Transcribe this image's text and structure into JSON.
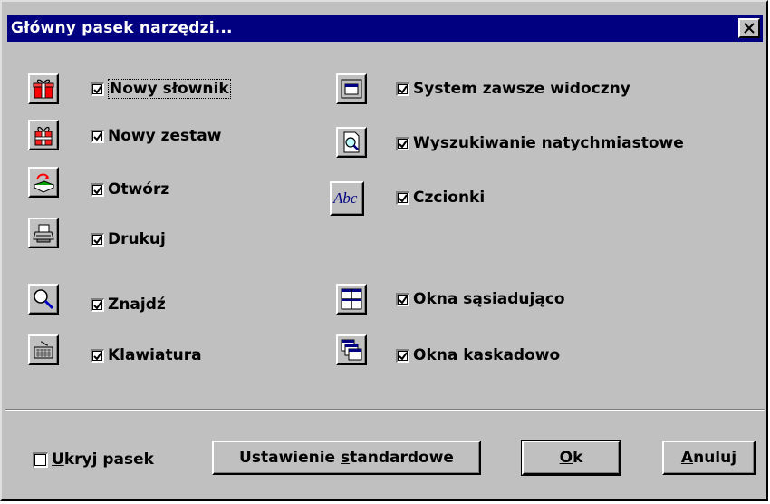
{
  "window": {
    "title": "Główny pasek narzędzi...",
    "close_label": "✕"
  },
  "left_options": [
    {
      "label": "Nowy słownik",
      "checked": true,
      "icon": "gift-new-dictionary-icon"
    },
    {
      "label": "Nowy zestaw",
      "checked": true,
      "icon": "gift-new-set-icon"
    },
    {
      "label": "Otwórz",
      "checked": true,
      "icon": "open-book-icon"
    },
    {
      "label": "Drukuj",
      "checked": true,
      "icon": "printer-icon"
    },
    {
      "label": "Znajdź",
      "checked": true,
      "icon": "magnifier-icon"
    },
    {
      "label": "Klawiatura",
      "checked": true,
      "icon": "keyboard-icon"
    }
  ],
  "right_options": [
    {
      "label": "System zawsze widoczny",
      "checked": true,
      "icon": "window-on-top-icon"
    },
    {
      "label": "Wyszukiwanie natychmiastowe",
      "checked": true,
      "icon": "document-search-icon"
    },
    {
      "label": "Czcionki",
      "checked": true,
      "icon": "fonts-abc-icon"
    },
    {
      "label": "Okna sąsiadująco",
      "checked": true,
      "icon": "tile-windows-icon"
    },
    {
      "label": "Okna kaskadowo",
      "checked": true,
      "icon": "cascade-windows-icon"
    }
  ],
  "footer": {
    "hide_bar": {
      "label_u": "U",
      "label_rest": "kryj pasek",
      "checked": false
    },
    "defaults_button": {
      "pre": "Ustawienie ",
      "u": "s",
      "post": "tandardowe"
    },
    "ok_button": {
      "u": "O",
      "post": "k"
    },
    "cancel_button": {
      "u": "A",
      "post": "nuluj"
    }
  },
  "colors": {
    "titlebar": "#000080",
    "face": "#c0c0c0"
  }
}
